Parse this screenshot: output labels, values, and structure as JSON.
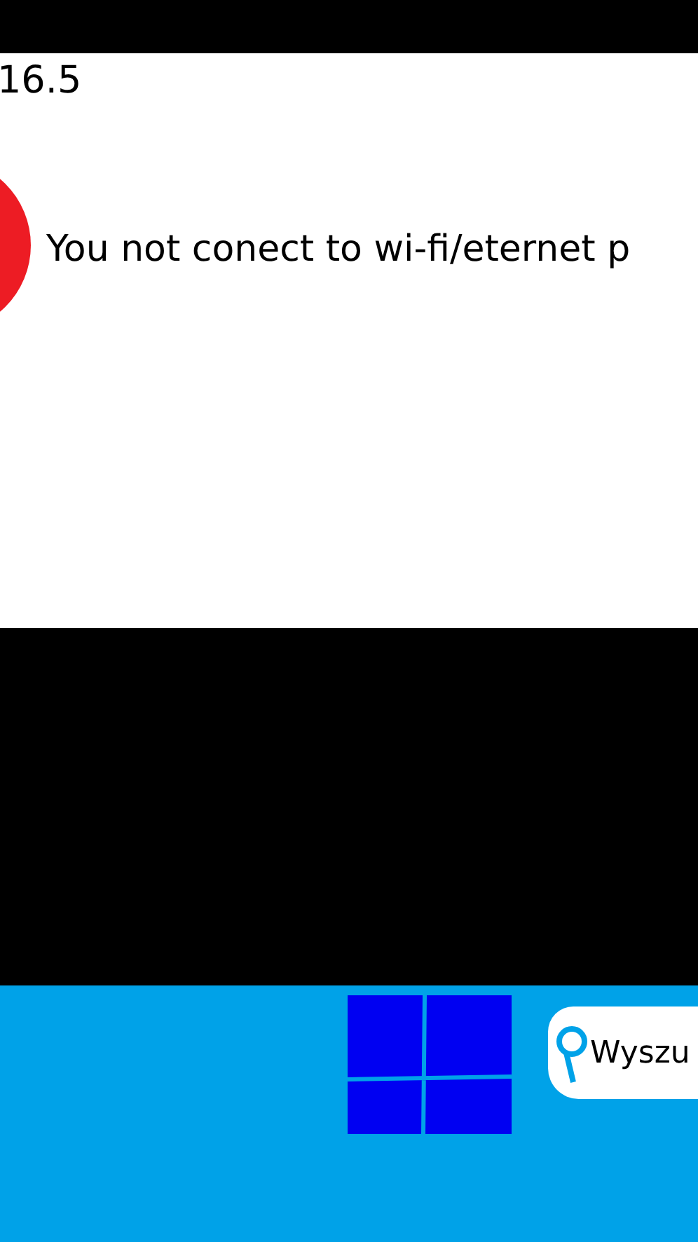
{
  "header": {
    "text": "16.5"
  },
  "message": {
    "text": "You not conect to wi-fi/eternet p"
  },
  "taskbar": {
    "search": {
      "placeholder": "Wyszu"
    }
  }
}
